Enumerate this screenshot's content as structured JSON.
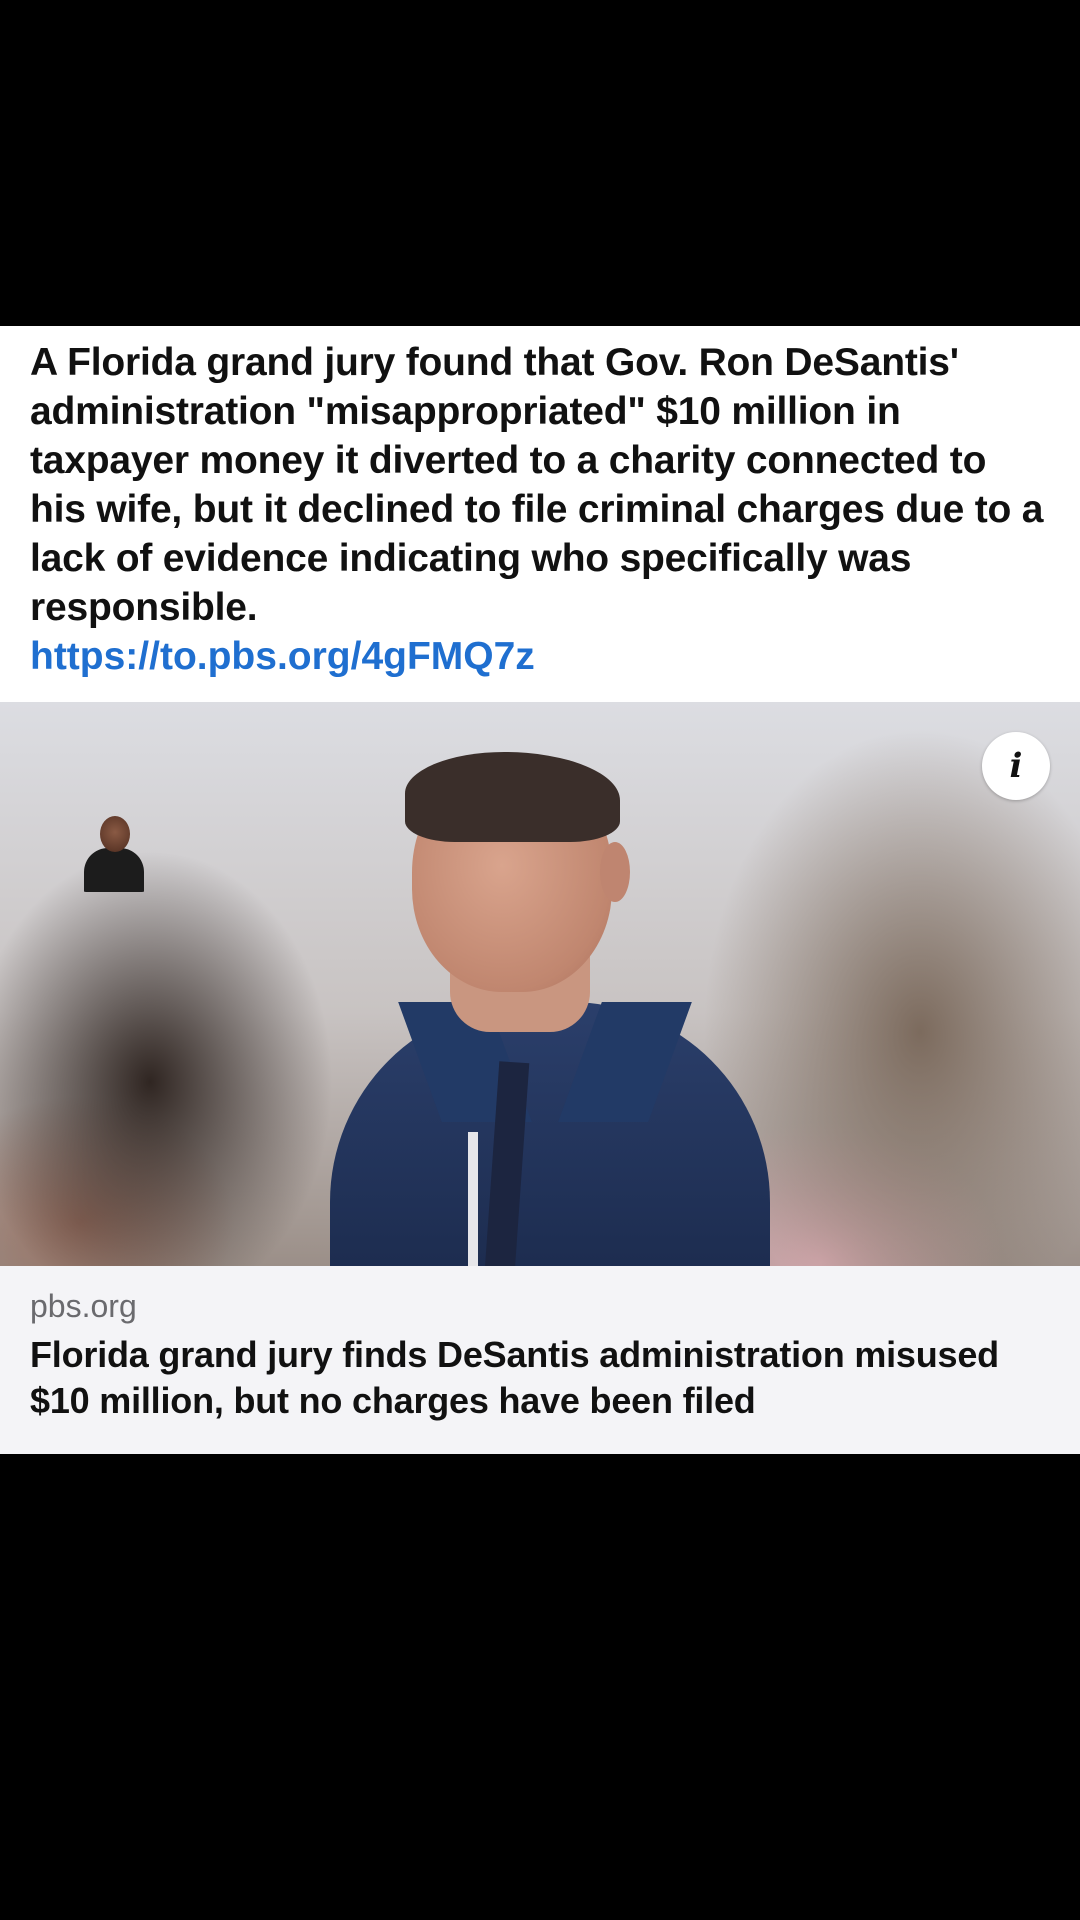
{
  "post": {
    "body": "A Florida grand jury found that Gov. Ron DeSantis' administration \"misappropriated\" $10 million in taxpayer money it diverted to a charity connected to his wife, but it declined to file criminal charges due to a lack of evidence indicating who specifically was responsible.",
    "link": "https://to.pbs.org/4gFMQ7z"
  },
  "preview": {
    "info_icon": "info-icon"
  },
  "card": {
    "domain": "pbs.org",
    "title": "Florida grand jury finds DeSantis administration misused $10 million, but no charges have been filed"
  }
}
